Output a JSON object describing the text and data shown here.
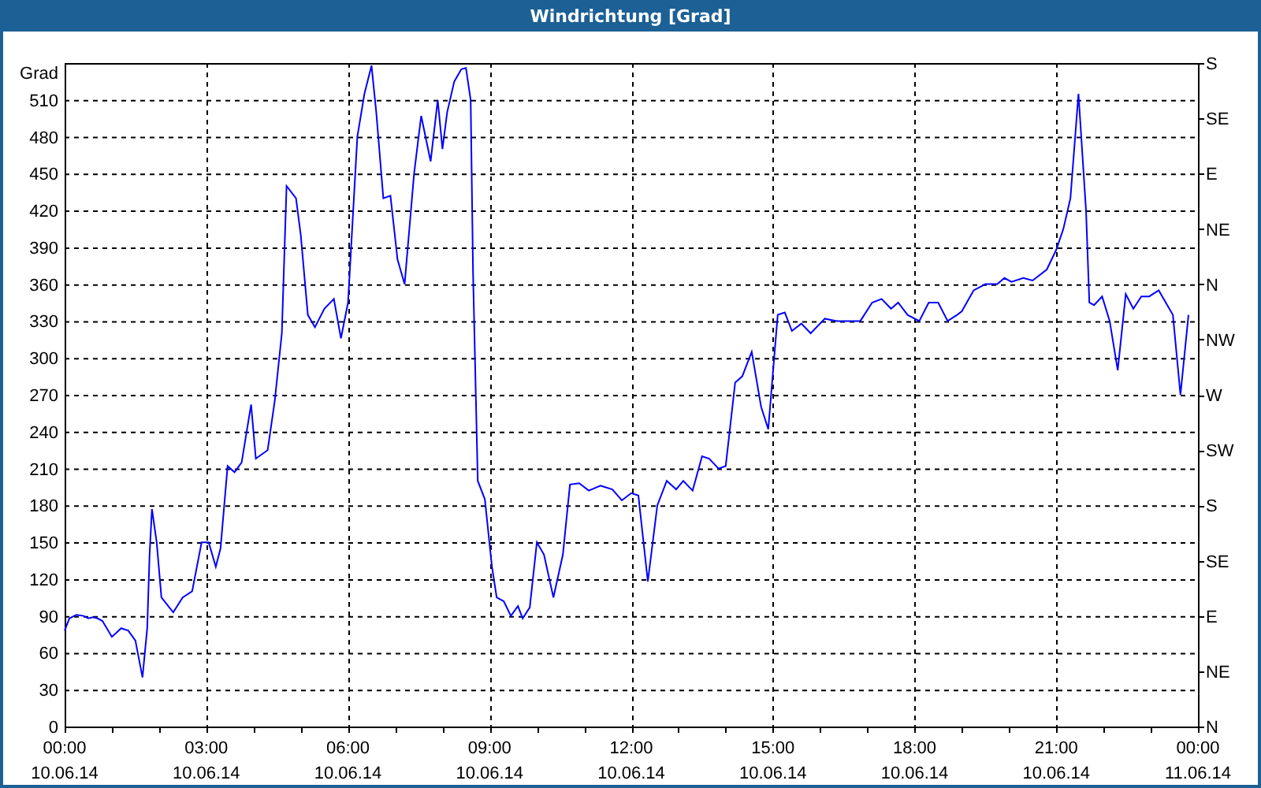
{
  "window": {
    "title": "Windrichtung [Grad]"
  },
  "chart": {
    "tick_dates": [
      "10.06.14",
      "10.06.14",
      "10.06.14",
      "10.06.14",
      "10.06.14",
      "10.06.14",
      "10.06.14",
      "10.06.14",
      "11.06.14"
    ],
    "compass_labels": [
      "S",
      "SE",
      "E",
      "NE",
      "N",
      "NW",
      "W",
      "SW",
      "S",
      "SE",
      "E",
      "NE",
      "N"
    ],
    "chart_data": {
      "type": "line",
      "grid": true,
      "ylabel": "Grad",
      "xlim": [
        0,
        24
      ],
      "ylim": [
        0,
        540
      ],
      "xticks": [
        {
          "value": 0,
          "label": "00:00"
        },
        {
          "value": 3,
          "label": "03:00"
        },
        {
          "value": 6,
          "label": "06:00"
        },
        {
          "value": 9,
          "label": "09:00"
        },
        {
          "value": 12,
          "label": "12:00"
        },
        {
          "value": 15,
          "label": "15:00"
        },
        {
          "value": 18,
          "label": "18:00"
        },
        {
          "value": 21,
          "label": "21:00"
        },
        {
          "value": 24,
          "label": "00:00"
        }
      ],
      "yticks": [
        0,
        30,
        60,
        90,
        120,
        150,
        180,
        210,
        240,
        270,
        300,
        330,
        360,
        390,
        420,
        450,
        480,
        510
      ],
      "x": [
        0,
        0.1,
        0.25,
        0.4,
        0.5,
        0.6,
        0.7,
        0.8,
        1.0,
        1.2,
        1.35,
        1.5,
        1.65,
        1.75,
        1.8,
        1.85,
        1.95,
        2.05,
        2.3,
        2.5,
        2.7,
        2.9,
        3.05,
        3.2,
        3.3,
        3.45,
        3.6,
        3.75,
        3.95,
        4.05,
        4.3,
        4.45,
        4.6,
        4.7,
        4.9,
        5.0,
        5.15,
        5.3,
        5.5,
        5.7,
        5.85,
        6.0,
        6.2,
        6.35,
        6.5,
        6.6,
        6.75,
        6.9,
        7.05,
        7.2,
        7.4,
        7.55,
        7.75,
        7.9,
        8.0,
        8.1,
        8.25,
        8.4,
        8.5,
        8.6,
        8.65,
        8.75,
        8.9,
        9.05,
        9.15,
        9.3,
        9.45,
        9.6,
        9.7,
        9.85,
        10.0,
        10.15,
        10.35,
        10.55,
        10.7,
        10.9,
        11.1,
        11.35,
        11.6,
        11.8,
        12.0,
        12.15,
        12.35,
        12.55,
        12.75,
        12.95,
        13.1,
        13.3,
        13.5,
        13.65,
        13.85,
        14.0,
        14.2,
        14.35,
        14.55,
        14.75,
        14.9,
        15.1,
        15.25,
        15.4,
        15.6,
        15.8,
        16.1,
        16.35,
        16.6,
        16.85,
        17.1,
        17.3,
        17.5,
        17.65,
        17.85,
        18.1,
        18.3,
        18.5,
        18.7,
        18.9,
        19.0,
        19.25,
        19.5,
        19.75,
        19.9,
        20.05,
        20.3,
        20.5,
        20.8,
        21.0,
        21.15,
        21.3,
        21.47,
        21.63,
        21.7,
        21.8,
        21.97,
        22.13,
        22.3,
        22.47,
        22.63,
        22.8,
        22.97,
        23.17,
        23.47,
        23.63,
        23.8
      ],
      "series": [
        {
          "color": "#0000ff",
          "values": [
            78,
            88,
            91,
            90,
            88,
            89,
            88,
            86,
            73,
            80,
            78,
            70,
            40,
            80,
            140,
            177,
            150,
            105,
            93,
            105,
            110,
            150,
            150,
            130,
            145,
            212,
            207,
            215,
            262,
            218,
            225,
            265,
            320,
            440,
            430,
            400,
            335,
            325,
            340,
            348,
            316,
            345,
            480,
            515,
            538,
            500,
            430,
            432,
            380,
            360,
            450,
            497,
            460,
            510,
            470,
            500,
            525,
            535,
            536,
            510,
            370,
            200,
            185,
            130,
            105,
            102,
            90,
            98,
            88,
            97,
            150,
            140,
            105,
            140,
            197,
            198,
            192,
            196,
            193,
            184,
            190,
            188,
            118,
            180,
            200,
            193,
            200,
            192,
            220,
            218,
            210,
            212,
            280,
            285,
            305,
            260,
            242,
            335,
            337,
            322,
            328,
            320,
            332,
            330,
            330,
            330,
            345,
            348,
            340,
            345,
            335,
            330,
            345,
            345,
            330,
            335,
            338,
            355,
            360,
            360,
            365,
            362,
            365,
            363,
            372,
            388,
            405,
            430,
            515,
            420,
            345,
            343,
            350,
            330,
            290,
            352,
            340,
            350,
            350,
            355,
            335,
            270,
            335
          ]
        }
      ]
    }
  }
}
